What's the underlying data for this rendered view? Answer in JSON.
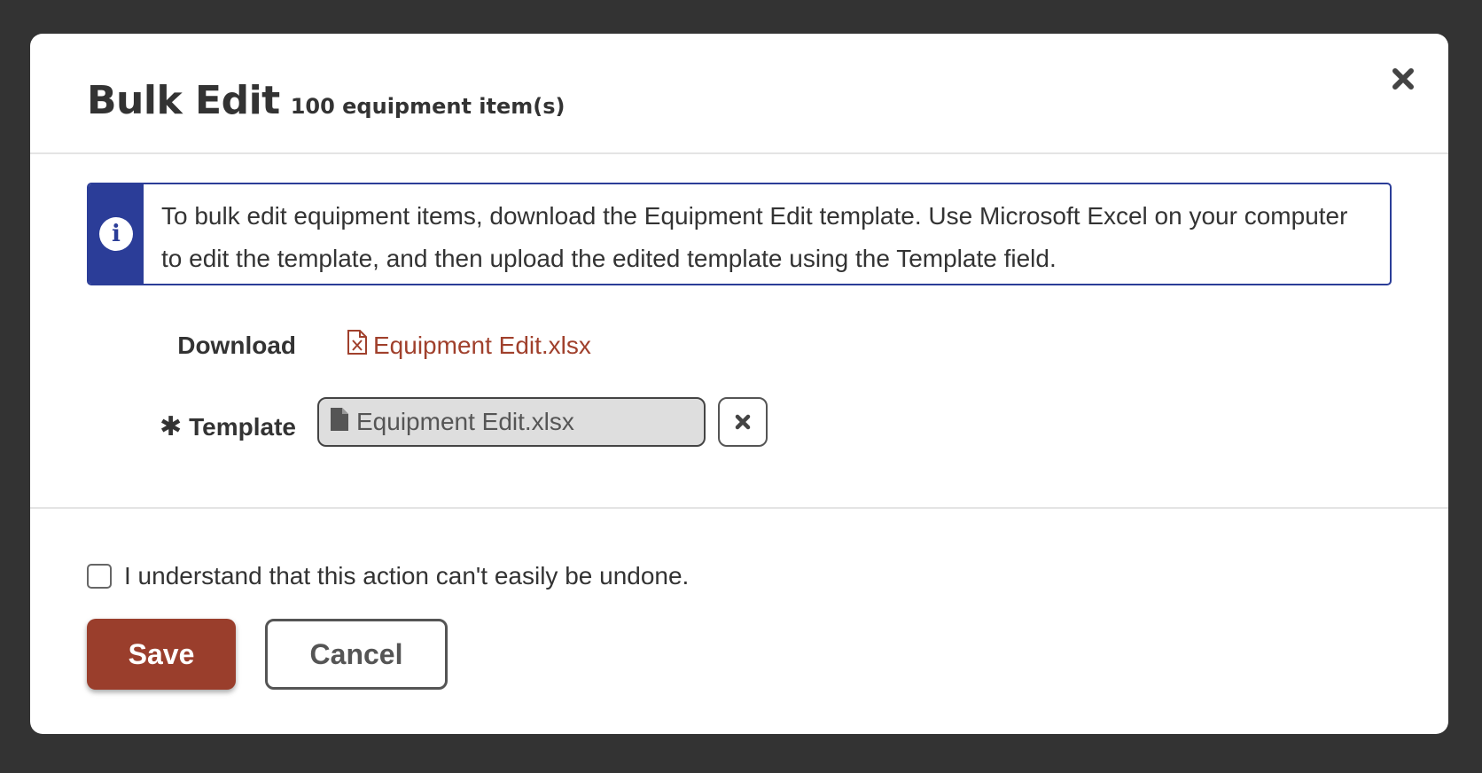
{
  "modal": {
    "title": "Bulk Edit",
    "subtitle": "100 equipment item(s)",
    "close_icon": "close-icon"
  },
  "info": {
    "icon": "info-icon",
    "line1": "To bulk edit equipment items, download the Equipment Edit template. Use Microsoft Excel on your computer",
    "line2": "to edit the template, and then upload the edited template using the Template field."
  },
  "download": {
    "label": "Download",
    "file_icon": "excel-file-icon",
    "link_text": "Equipment Edit.xlsx"
  },
  "template": {
    "required_marker": "✱",
    "label": "Template",
    "file_icon": "file-icon",
    "value": "Equipment Edit.xlsx",
    "clear_icon": "clear-icon"
  },
  "footer": {
    "confirm_text": "I understand that this action can't easily be undone.",
    "confirm_checked": false,
    "save_label": "Save",
    "cancel_label": "Cancel"
  },
  "colors": {
    "backdrop": "#333333",
    "info_accent": "#2b3d98",
    "link": "#a0402c",
    "save_button": "#9a3e2c"
  }
}
